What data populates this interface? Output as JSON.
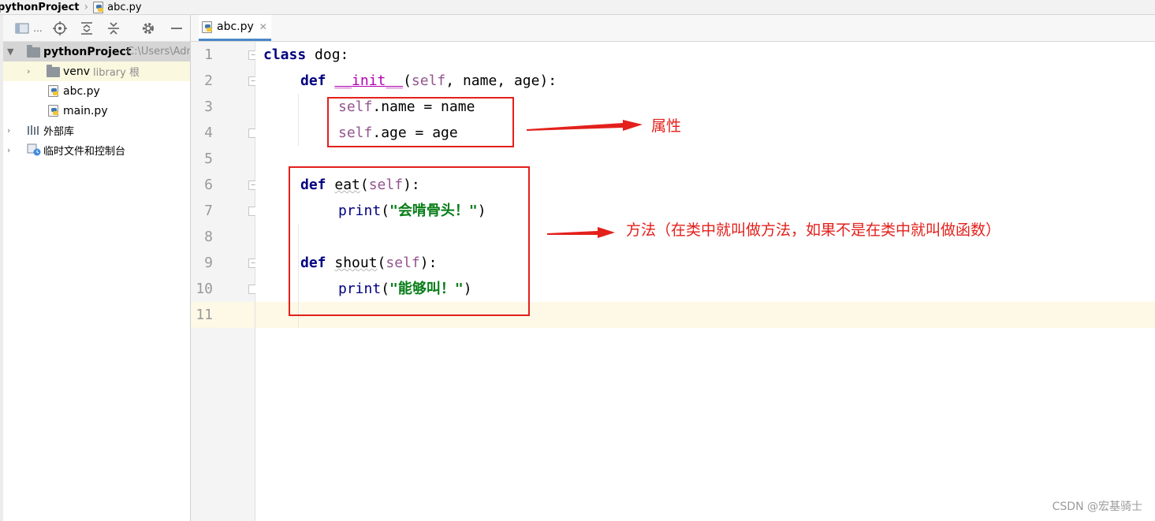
{
  "breadcrumb": {
    "project": "pythonProject",
    "file": "abc.py"
  },
  "project_panel": {
    "toolbar_icons": [
      "project-view-icon",
      "locate-icon",
      "expand-all-icon",
      "collapse-all-icon",
      "gear-icon",
      "minimize-icon"
    ],
    "toolbar_view_label": "...",
    "tree": {
      "root_name": "pythonProject",
      "root_path": "C:\\Users\\Adm",
      "venv_name": "venv",
      "venv_hint": "library 根",
      "file_abc": "abc.py",
      "file_main": "main.py",
      "external_libs": "外部库",
      "scratches": "临时文件和控制台"
    }
  },
  "editor": {
    "tab_label": "abc.py",
    "line_numbers": [
      "1",
      "2",
      "3",
      "4",
      "5",
      "6",
      "7",
      "8",
      "9",
      "10",
      "11"
    ],
    "code": {
      "l1_kw": "class",
      "l1_rest": " dog:",
      "l2_kw": "def",
      "l2_fn": "__init__",
      "l2_open": "(",
      "l2_self": "self",
      "l2_rest": ", name, age):",
      "l3_self": "self",
      "l3_rest": ".name = name",
      "l4_self": "self",
      "l4_rest": ".age = age",
      "l6_kw": "def",
      "l6_fn": "eat",
      "l6_open": "(",
      "l6_self": "self",
      "l6_close": "):",
      "l7_fn": "print",
      "l7_open": "(",
      "l7_str": "\"会啃骨头！\"",
      "l7_close": ")",
      "l9_kw": "def",
      "l9_fn": "shout",
      "l9_open": "(",
      "l9_self": "self",
      "l9_close": "):",
      "l10_fn": "print",
      "l10_open": "(",
      "l10_str": "\"能够叫！\"",
      "l10_close": ")"
    }
  },
  "annotations": {
    "attributes_label": "属性",
    "methods_label": "方法（在类中就叫做方法，如果不是在类中就叫做函数）",
    "color": "#e3201b"
  },
  "watermark": "CSDN @宏基骑士"
}
